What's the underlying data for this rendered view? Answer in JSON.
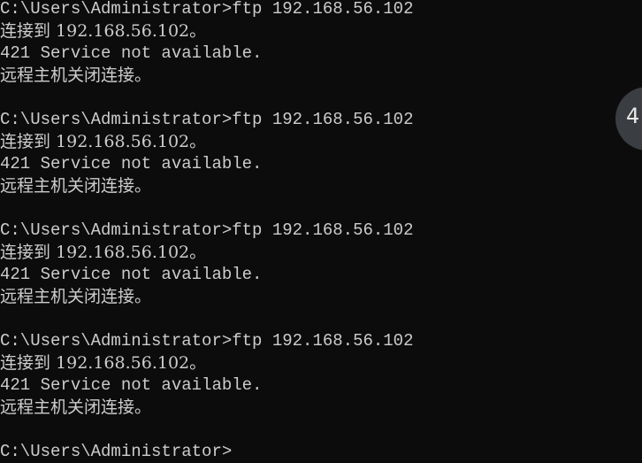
{
  "console": {
    "lines": [
      "C:\\Users\\Administrator>ftp 192.168.56.102",
      "连接到 192.168.56.102。",
      "421 Service not available.",
      "远程主机关闭连接。",
      "",
      "C:\\Users\\Administrator>ftp 192.168.56.102",
      "连接到 192.168.56.102。",
      "421 Service not available.",
      "远程主机关闭连接。",
      "",
      "C:\\Users\\Administrator>ftp 192.168.56.102",
      "连接到 192.168.56.102。",
      "421 Service not available.",
      "远程主机关闭连接。",
      "",
      "C:\\Users\\Administrator>ftp 192.168.56.102",
      "连接到 192.168.56.102。",
      "421 Service not available.",
      "远程主机关闭连接。",
      "",
      "C:\\Users\\Administrator>"
    ]
  },
  "badge": {
    "text": "4"
  },
  "colors": {
    "background": "#0c0c0c",
    "text": "#cccccc",
    "badge": "#3a3d42"
  }
}
